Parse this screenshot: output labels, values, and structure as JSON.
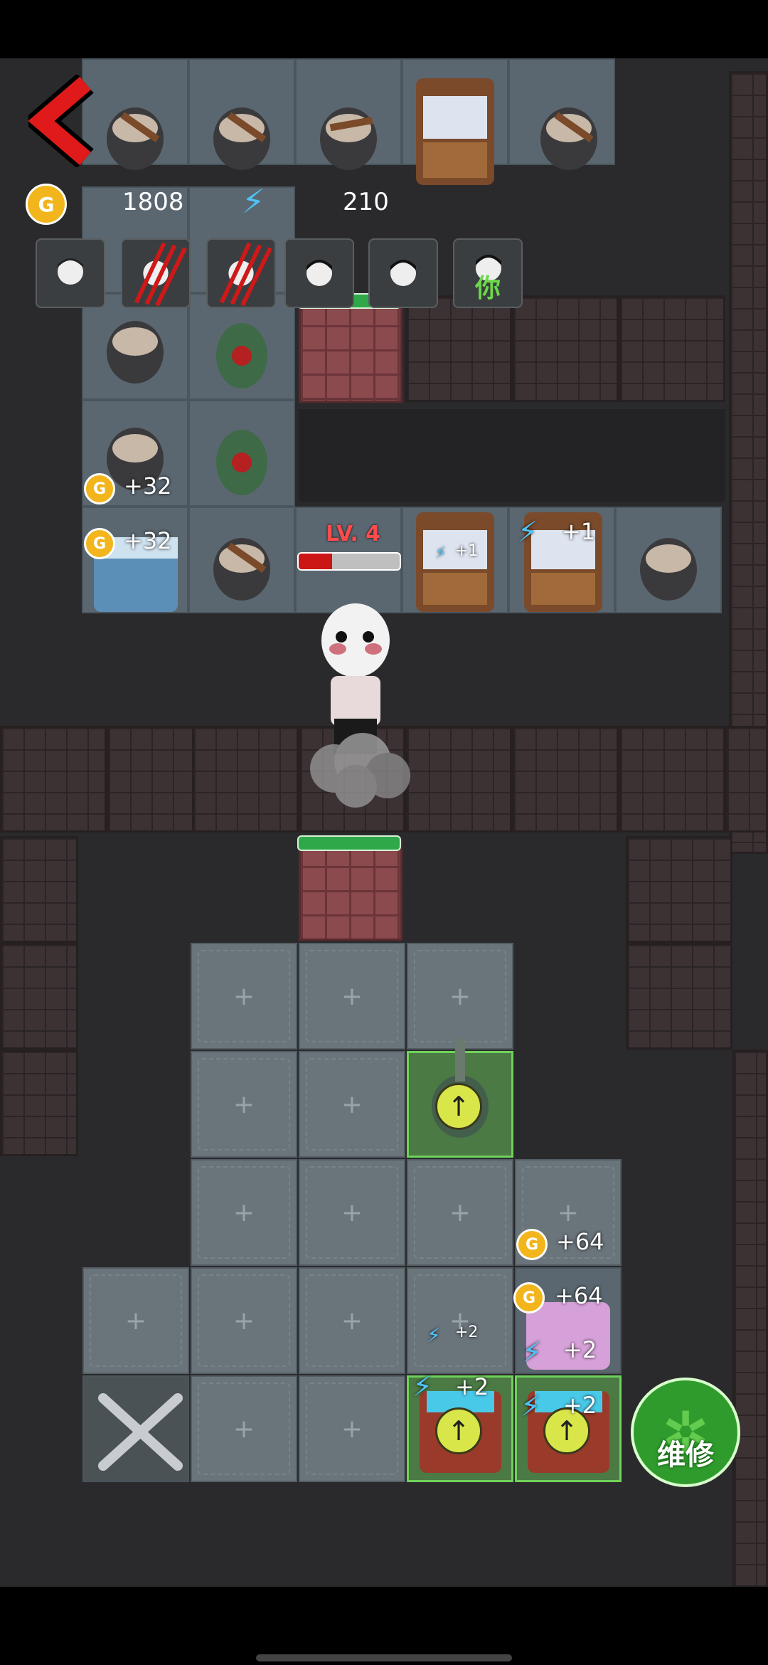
{
  "hud": {
    "back_icon": "back-chevron-icon",
    "coin_letter": "G",
    "gold": "1808",
    "energy": "210",
    "energy_icon": "lightning-icon"
  },
  "players": [
    {
      "name": "player-1",
      "status": "alive"
    },
    {
      "name": "player-2",
      "status": "attacked"
    },
    {
      "name": "player-3",
      "status": "attacked"
    },
    {
      "name": "player-4",
      "status": "alive"
    },
    {
      "name": "player-5",
      "status": "alive"
    },
    {
      "name": "player-you",
      "status": "alive",
      "tag": "你"
    }
  ],
  "enemy": {
    "level_label": "LV. 4",
    "health_fraction": 0.33
  },
  "resource_popups": {
    "coin_room_a": "+32",
    "coin_room_b": "+32",
    "energy_room_a": "+1",
    "energy_room_b": "+1",
    "coin_you_a": "+64",
    "coin_you_b": "+64",
    "energy_you_a": "+2",
    "energy_you_b": "+2",
    "energy_you_c": "+2",
    "energy_you_d": "+2"
  },
  "actions": {
    "repair_label": "维修"
  },
  "colors": {
    "accent_green": "#2f9b2d",
    "enemy_red": "#ff4b4b",
    "coin_gold": "#f2b51c",
    "energy_blue": "#4fc3f7"
  }
}
